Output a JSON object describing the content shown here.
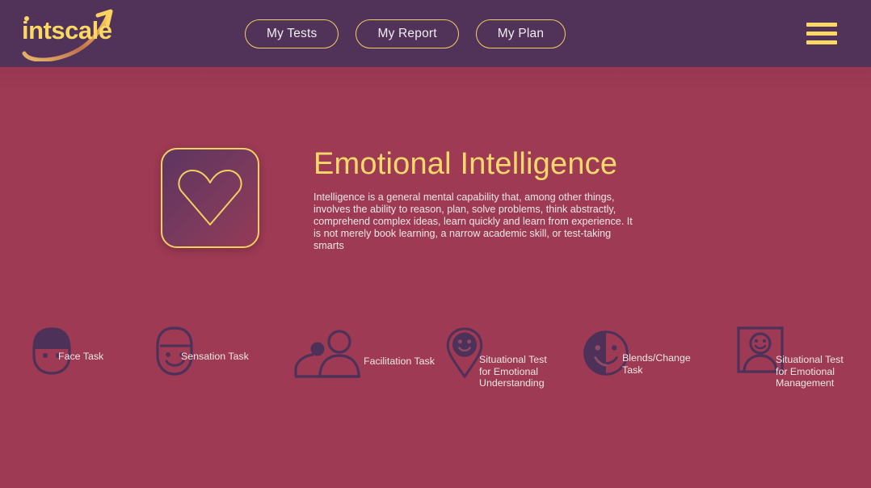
{
  "brand": {
    "name": "intscale",
    "logo_icon": "intscale-arrow-logo"
  },
  "header": {
    "nav": [
      {
        "label": "My Tests",
        "name": "nav-my-tests"
      },
      {
        "label": "My Report",
        "name": "nav-my-report"
      },
      {
        "label": "My Plan",
        "name": "nav-my-plan"
      }
    ],
    "menu_icon": "hamburger-menu-icon"
  },
  "hero": {
    "icon": "heart-icon",
    "title": "Emotional Intelligence",
    "description": "Intelligence is a general mental capability that, among other things, involves the ability to reason, plan, solve problems, think abstractly, comprehend complex ideas, learn quickly and learn from experience. It is not merely book learning, a narrow academic skill, or test-taking smarts"
  },
  "tasks": [
    {
      "label": "Face Task",
      "icon": "face-with-hair-icon"
    },
    {
      "label": "Sensation Task",
      "icon": "smiling-face-mask-icon"
    },
    {
      "label": "Facilitation Task",
      "icon": "two-people-icon"
    },
    {
      "label": "Situational Test\nfor Emotional\nUnderstanding",
      "icon": "map-pin-smiley-icon"
    },
    {
      "label": "Blends/Change\nTask",
      "icon": "half-filled-smiley-icon"
    },
    {
      "label": "Situational Test\nfor Emotional\nManagement",
      "icon": "framed-person-icon"
    }
  ],
  "colors": {
    "header_purple": "#513259",
    "body_crimson": "#9e3a54",
    "gold": "#f3cf60",
    "gold_bright": "#fbd864",
    "title_gold": "#f7d86a",
    "text_cream": "#f2e7e4",
    "icon_purple": "#4d3159"
  }
}
